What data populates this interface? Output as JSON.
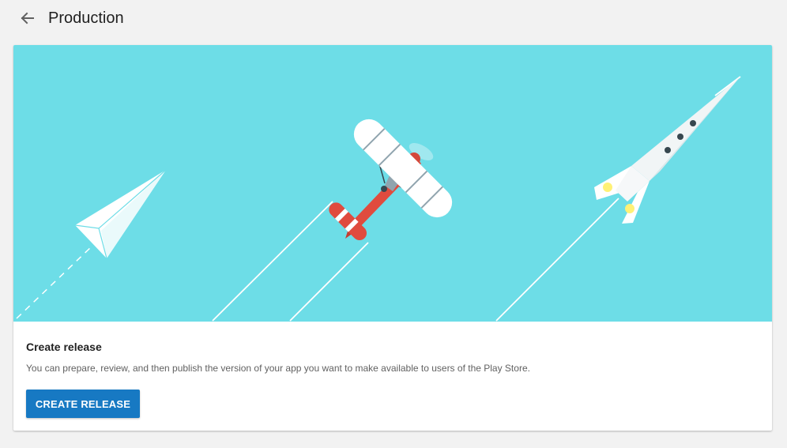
{
  "header": {
    "back_icon": "arrow-back-icon",
    "title": "Production"
  },
  "hero": {
    "background_color": "#6ddde7",
    "illustrations": [
      "paper-plane",
      "biplane",
      "rocket"
    ]
  },
  "card": {
    "title": "Create release",
    "description": "You can prepare, review, and then publish the version of your app you want to make available to users of the Play Store.",
    "button_label": "CREATE RELEASE",
    "button_color": "#1779c3"
  }
}
